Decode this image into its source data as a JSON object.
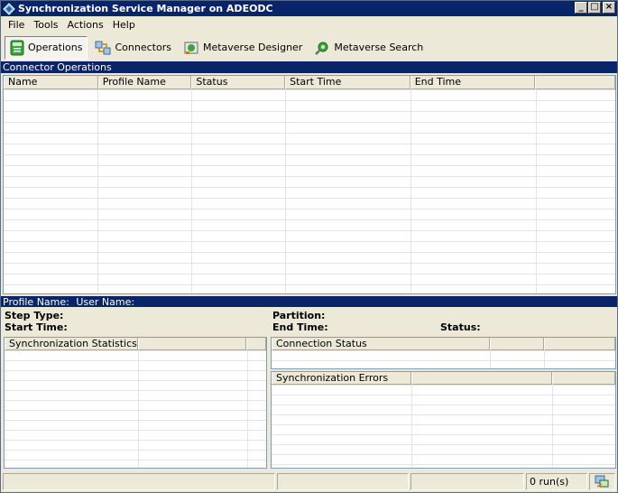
{
  "window": {
    "title": "Synchronization Service Manager on ADEODC",
    "buttons": {
      "minimize": "_",
      "maximize": "□",
      "close": "×"
    }
  },
  "menu": [
    "File",
    "Tools",
    "Actions",
    "Help"
  ],
  "toolbar": {
    "operations": "Operations",
    "connectors": "Connectors",
    "metaverse_designer": "Metaverse Designer",
    "metaverse_search": "Metaverse Search"
  },
  "connector_operations": {
    "header": "Connector Operations",
    "columns": [
      "Name",
      "Profile Name",
      "Status",
      "Start Time",
      "End Time",
      ""
    ]
  },
  "profile_bar": {
    "profile_name_label": "Profile Name:",
    "user_name_label": "User Name:"
  },
  "details": {
    "step_type_label": "Step Type:",
    "start_time_label": "Start Time:",
    "partition_label": "Partition:",
    "end_time_label": "End Time:",
    "status_label": "Status:"
  },
  "sync_statistics": {
    "columns": [
      "Synchronization Statistics",
      "",
      ""
    ]
  },
  "connection_status": {
    "columns": [
      "Connection Status",
      "",
      ""
    ]
  },
  "sync_errors": {
    "columns": [
      "Synchronization Errors",
      "",
      ""
    ]
  },
  "statusbar": {
    "runs": "0 run(s)"
  },
  "colors": {
    "title_bar": "#0a246a",
    "chrome": "#ece9d8",
    "grid_line": "#e4e4e4"
  }
}
